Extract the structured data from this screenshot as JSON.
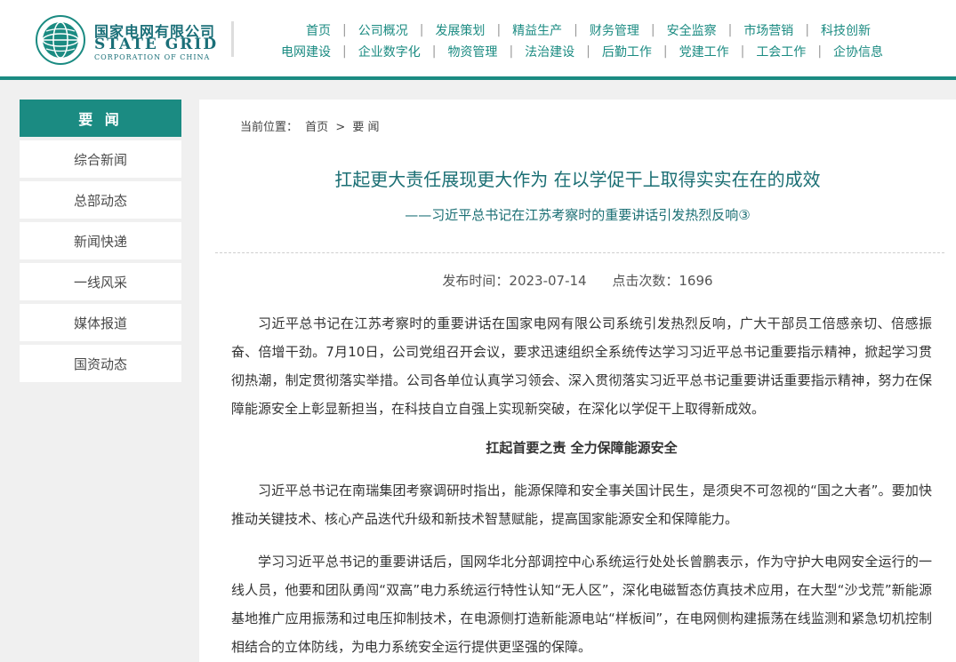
{
  "brand": {
    "name_cn": "国家电网有限公司",
    "name_en": "STATE GRID",
    "name_en_sub": "CORPORATION OF CHINA",
    "color": "#1b8b82"
  },
  "nav": {
    "row1": [
      "首页",
      "公司概况",
      "发展策划",
      "精益生产",
      "财务管理",
      "安全监察",
      "市场营销",
      "科技创新"
    ],
    "row2": [
      "电网建设",
      "企业数字化",
      "物资管理",
      "法治建设",
      "后勤工作",
      "党建工作",
      "工会工作",
      "企协信息"
    ]
  },
  "sidebar": {
    "title": "要 闻",
    "items": [
      "综合新闻",
      "总部动态",
      "新闻快递",
      "一线风采",
      "媒体报道",
      "国资动态"
    ]
  },
  "breadcrumb": {
    "prefix": "当前位置：",
    "home": "首页",
    "sep": ">",
    "current": "要 闻"
  },
  "article": {
    "title": "扛起更大责任展现更大作为 在以学促干上取得实实在在的成效",
    "subtitle": "——习近平总书记在江苏考察时的重要讲话引发热烈反响③",
    "publish": "发布时间：2023-07-14",
    "clicks": "点击次数：1696",
    "p1": "习近平总书记在江苏考察时的重要讲话在国家电网有限公司系统引发热烈反响，广大干部员工倍感亲切、倍感振奋、倍增干劲。7月10日，公司党组召开会议，要求迅速组织全系统传达学习习近平总书记重要指示精神，掀起学习贯彻热潮，制定贯彻落实举措。公司各单位认真学习领会、深入贯彻落实习近平总书记重要讲话重要指示精神，努力在保障能源安全上彰显新担当，在科技自立自强上实现新突破，在深化以学促干上取得新成效。",
    "section1": "扛起首要之责 全力保障能源安全",
    "p2": "习近平总书记在南瑞集团考察调研时指出，能源保障和安全事关国计民生，是须臾不可忽视的“国之大者”。要加快推动关键技术、核心产品迭代升级和新技术智慧赋能，提高国家能源安全和保障能力。",
    "p3": "学习习近平总书记的重要讲话后，国网华北分部调控中心系统运行处处长曾鹏表示，作为守护大电网安全运行的一线人员，他要和团队勇闯“双高”电力系统运行特性认知“无人区”，深化电磁暂态仿真技术应用，在大型“沙戈荒”新能源基地推广应用振荡和过电压抑制技术，在电源侧打造新能源电站“样板间”，在电网侧构建振荡在线监测和紧急切机控制相结合的立体防线，为电力系统安全运行提供更坚强的保障。"
  }
}
